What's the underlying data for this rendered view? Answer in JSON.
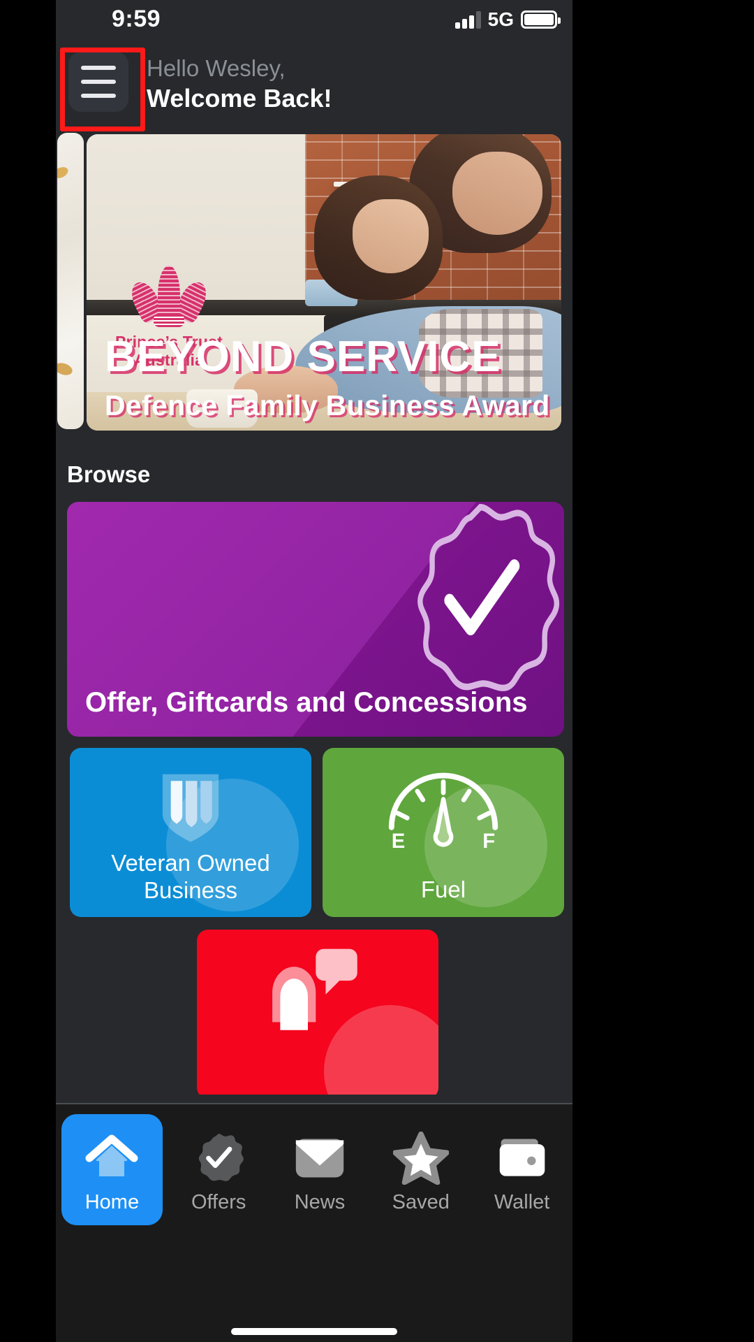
{
  "status_bar": {
    "time": "9:59",
    "network": "5G",
    "signal_icon": "signal-bars-icon",
    "battery_icon": "battery-full-icon"
  },
  "header": {
    "menu_icon": "hamburger-menu-icon",
    "greeting_line1": "Hello Wesley,",
    "greeting_line2": "Welcome Back!",
    "highlight_color": "#ff1a1a"
  },
  "carousel": {
    "logo_text_line1": "Prince’s Trust",
    "logo_text_line2": "Australia",
    "logo_icon": "princes-trust-feathers-icon",
    "banner_title": "BEYOND SERVICE",
    "banner_subtitle": "Defence Family Business Award",
    "logo_color": "#d6316a"
  },
  "browse": {
    "section_title": "Browse",
    "cards": [
      {
        "label": "Offer, Giftcards and Concessions",
        "icon": "verified-check-badge-icon",
        "color": "#9b1ca8"
      },
      {
        "label": "Veteran Owned Business",
        "icon": "shield-icon",
        "color": "#0b8dd6"
      },
      {
        "label": "Fuel",
        "icon": "fuel-gauge-icon",
        "gauge_empty_label": "E",
        "gauge_full_label": "F",
        "color": "#5fa63d"
      },
      {
        "label": "",
        "icon": "support-person-chat-icon",
        "color": "#f5051e"
      }
    ]
  },
  "tab_bar": {
    "active_color": "#1e90f5",
    "tabs": [
      {
        "label": "Home",
        "icon": "home-icon",
        "active": true
      },
      {
        "label": "Offers",
        "icon": "check-badge-icon",
        "active": false
      },
      {
        "label": "News",
        "icon": "envelope-icon",
        "active": false
      },
      {
        "label": "Saved",
        "icon": "star-icon",
        "active": false
      },
      {
        "label": "Wallet",
        "icon": "wallet-icon",
        "active": false
      }
    ]
  }
}
